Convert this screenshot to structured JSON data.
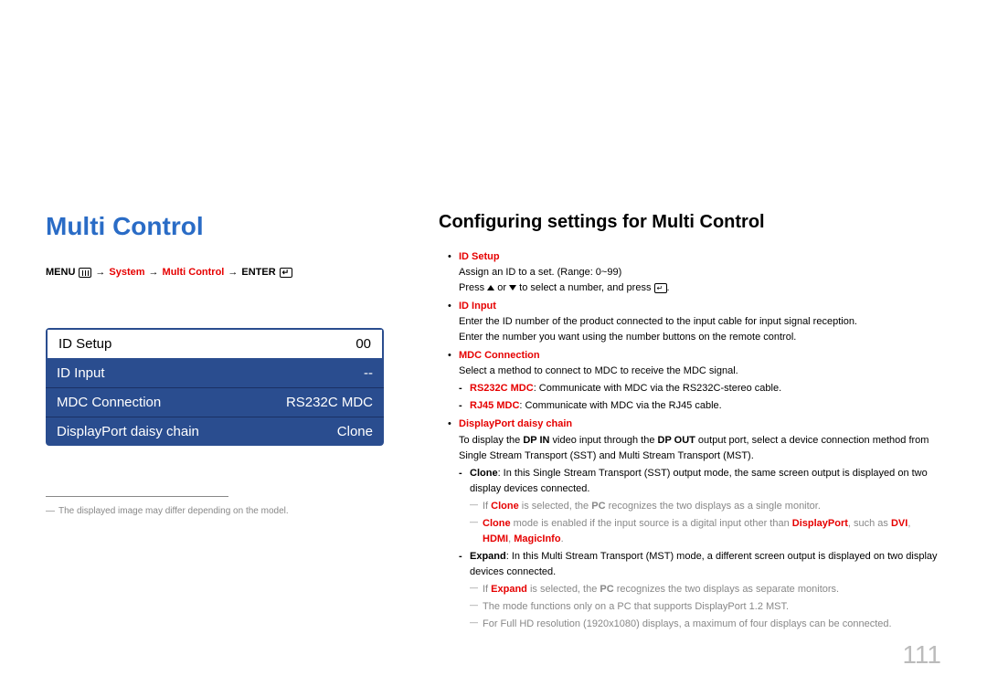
{
  "left": {
    "title": "Multi Control",
    "path": {
      "menu": "MENU",
      "system": "System",
      "multi": "Multi Control",
      "enter": "ENTER"
    },
    "menu": [
      {
        "label": "ID Setup",
        "value": "00"
      },
      {
        "label": "ID Input",
        "value": "--"
      },
      {
        "label": "MDC Connection",
        "value": "RS232C MDC"
      },
      {
        "label": "DisplayPort daisy chain",
        "value": "Clone"
      }
    ],
    "footnote": "The displayed image may differ depending on the model."
  },
  "right": {
    "title": "Configuring settings for Multi Control",
    "idsetup": {
      "label": "ID Setup",
      "l1": "Assign an ID to a set. (Range: 0~99)",
      "l2a": "Press ",
      "l2b": " or ",
      "l2c": " to select a number, and press ",
      "l2d": "."
    },
    "idinput": {
      "label": "ID Input",
      "l1": "Enter the ID number of the product connected to the input cable for input signal reception.",
      "l2": "Enter the number you want using the number buttons on the remote control."
    },
    "mdc": {
      "label": "MDC Connection",
      "l1": "Select a method to connect to MDC to receive the MDC signal.",
      "rs": {
        "label": "RS232C MDC",
        "text": ": Communicate with MDC via the RS232C-stereo cable."
      },
      "rj": {
        "label": "RJ45 MDC",
        "text": ": Communicate with MDC via the RJ45 cable."
      }
    },
    "dp": {
      "label": "DisplayPort daisy chain",
      "l1a": "To display the ",
      "l1b": "DP IN",
      "l1c": " video input through the ",
      "l1d": "DP OUT",
      "l1e": " output port, select a device connection method from Single Stream Transport (SST) and Multi Stream Transport (MST).",
      "clone": {
        "label": "Clone",
        "text": ": In this Single Stream Transport (SST) output mode, the same screen output is displayed on two display devices connected."
      },
      "n1a": "If ",
      "n1b": "Clone",
      "n1c": " is selected, the ",
      "n1d": "PC",
      "n1e": " recognizes the two displays as a single monitor.",
      "n2a": "Clone",
      "n2b": " mode is enabled if the input source is a digital input other than ",
      "n2c": "DisplayPort",
      "n2d": ", such as ",
      "n2e": "DVI",
      "n2f": ", ",
      "n2g": "HDMI",
      "n2h": ", ",
      "n2i": "MagicInfo",
      "n2j": ".",
      "expand": {
        "label": "Expand",
        "text": ": In this Multi Stream Transport (MST) mode, a different screen output is displayed on two display devices connected."
      },
      "n3a": "If ",
      "n3b": "Expand",
      "n3c": " is selected, the ",
      "n3d": "PC",
      "n3e": " recognizes the two displays as separate monitors.",
      "n4": "The mode functions only on a PC that supports DisplayPort 1.2 MST.",
      "n5": "For Full HD resolution (1920x1080) displays, a maximum of four displays can be connected."
    }
  },
  "page": "111"
}
